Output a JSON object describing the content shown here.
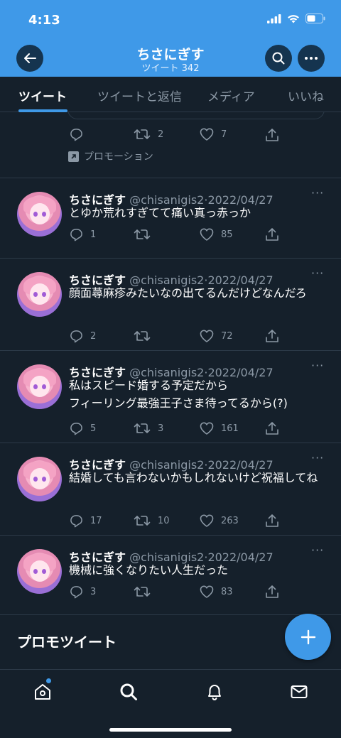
{
  "status_bar": {
    "time": "4:13"
  },
  "header": {
    "title": "ちさにぎす",
    "subtitle": "ツイート 342",
    "color": "#3f99e8"
  },
  "tabs": [
    {
      "label": "ツイート",
      "active": true
    },
    {
      "label": "ツイートと返信",
      "active": false
    },
    {
      "label": "メディア",
      "active": false
    },
    {
      "label": "いいね",
      "active": false
    }
  ],
  "promo_tweet_partial": {
    "reply_count": "",
    "retweet_count": "2",
    "like_count": "7",
    "promotion_label": "プロモーション"
  },
  "tweets": [
    {
      "name": "ちさにぎす",
      "handle": "@chisanigis2",
      "date": "2022/04/27",
      "text": "とゆか荒れすぎてて痛い真っ赤っか",
      "replies": "1",
      "retweets": "",
      "likes": "85"
    },
    {
      "name": "ちさにぎす",
      "handle": "@chisanigis2",
      "date": "2022/04/27",
      "text": "顔面蕁麻疹みたいなの出てるんだけどなんだろ",
      "replies": "2",
      "retweets": "",
      "likes": "72"
    },
    {
      "name": "ちさにぎす",
      "handle": "@chisanigis2",
      "date": "2022/04/27",
      "text": "私はスピード婚する予定だから\nフィーリング最強王子さま待ってるから(?)",
      "replies": "5",
      "retweets": "3",
      "likes": "161"
    },
    {
      "name": "ちさにぎす",
      "handle": "@chisanigis2",
      "date": "2022/04/27",
      "text": "結婚しても言わないかもしれないけど祝福してね",
      "replies": "17",
      "retweets": "10",
      "likes": "263"
    },
    {
      "name": "ちさにぎす",
      "handle": "@chisanigis2",
      "date": "2022/04/27",
      "text": "機械に強くなりたい人生だった",
      "replies": "3",
      "retweets": "",
      "likes": "83"
    }
  ],
  "promo_section": {
    "heading": "プロモツイート"
  },
  "bottom_nav": [
    {
      "icon": "home-icon",
      "has_notification_dot": true
    },
    {
      "icon": "search-icon"
    },
    {
      "icon": "bell-icon"
    },
    {
      "icon": "mail-icon"
    }
  ],
  "colors": {
    "background": "#15202b",
    "accent": "#3f99e8",
    "muted_text": "#8b98a5",
    "divider": "#2c3a48"
  }
}
